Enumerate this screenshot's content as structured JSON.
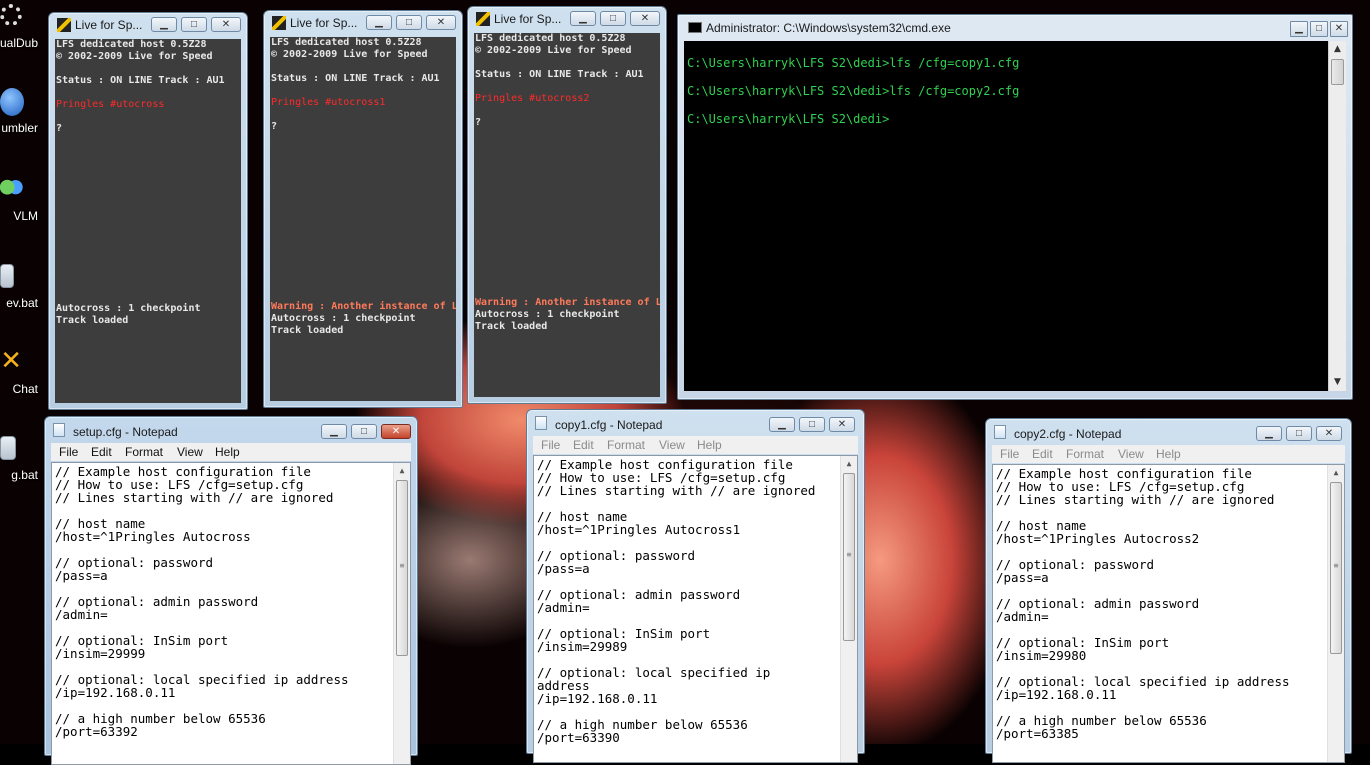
{
  "desktop": {
    "icons": [
      {
        "label": "ualDub",
        "icon": "virtualdub-gear-icon"
      },
      {
        "label": "umbler",
        "icon": "stumbleupon-icon"
      },
      {
        "label": "VLM",
        "icon": "windows-live-messenger-icon"
      },
      {
        "label": "ev.bat",
        "icon": "batch-file-icon"
      },
      {
        "label": "Chat",
        "icon": "chat-x-icon"
      },
      {
        "label": "g.bat",
        "icon": "batch-file-icon"
      }
    ]
  },
  "lfs_windows": [
    {
      "title": "Live for Sp...",
      "lines": {
        "header1": "LFS dedicated host 0.5Z28",
        "header2": "© 2002-2009 Live for Speed",
        "status": "Status : ON LINE    Track : AU1",
        "host": "Pringles #utocross",
        "prompt": "?",
        "warning": "",
        "checkpoint": "Autocross : 1 checkpoint",
        "loaded": "Track loaded"
      }
    },
    {
      "title": "Live for Sp...",
      "lines": {
        "header1": "LFS dedicated host 0.5Z28",
        "header2": "© 2002-2009 Live for Speed",
        "status": "Status : ON LINE    Track : AU1",
        "host": "Pringles #utocross1",
        "prompt": "?",
        "warning": "Warning : Another instance of LFS is",
        "checkpoint": "Autocross : 1 checkpoint",
        "loaded": "Track loaded"
      }
    },
    {
      "title": "Live for Sp...",
      "lines": {
        "header1": "LFS dedicated host 0.5Z28",
        "header2": "© 2002-2009 Live for Speed",
        "status": "Status : ON LINE    Track : AU1",
        "host": "Pringles #utocross2",
        "prompt": "?",
        "warning": "Warning : Another instance of LFS is",
        "checkpoint": "Autocross : 1 checkpoint",
        "loaded": "Track loaded"
      }
    }
  ],
  "cmd": {
    "title": "Administrator: C:\\Windows\\system32\\cmd.exe",
    "lines": [
      "C:\\Users\\harryk\\LFS S2\\dedi>lfs /cfg=copy1.cfg",
      "C:\\Users\\harryk\\LFS S2\\dedi>lfs /cfg=copy2.cfg",
      "C:\\Users\\harryk\\LFS S2\\dedi>"
    ]
  },
  "notepad_menu": [
    "File",
    "Edit",
    "Format",
    "View",
    "Help"
  ],
  "notepads": [
    {
      "title": "setup.cfg - Notepad",
      "lines": [
        "// Example host configuration file",
        "// How to use: LFS /cfg=setup.cfg",
        "// Lines starting with // are ignored",
        "",
        "// host name",
        "/host=^1Pringles Autocross",
        "",
        "// optional: password",
        "/pass=a",
        "",
        "// optional: admin password",
        "/admin=",
        "",
        "// optional: InSim port",
        "/insim=29999",
        "",
        "// optional: local specified ip address",
        "/ip=192.168.0.11",
        "",
        "// a high number below 65536",
        "/port=63392"
      ]
    },
    {
      "title": "copy1.cfg - Notepad",
      "lines": [
        "// Example host configuration file",
        "// How to use: LFS /cfg=setup.cfg",
        "// Lines starting with // are ignored",
        "",
        "// host name",
        "/host=^1Pringles Autocross1",
        "",
        "// optional: password",
        "/pass=a",
        "",
        "// optional: admin password",
        "/admin=",
        "",
        "// optional: InSim port",
        "/insim=29989",
        "",
        "// optional: local specified ip",
        "address",
        "/ip=192.168.0.11",
        "",
        "// a high number below 65536",
        "/port=63390"
      ]
    },
    {
      "title": "copy2.cfg - Notepad",
      "lines": [
        "// Example host configuration file",
        "// How to use: LFS /cfg=setup.cfg",
        "// Lines starting with // are ignored",
        "",
        "// host name",
        "/host=^1Pringles Autocross2",
        "",
        "// optional: password",
        "/pass=a",
        "",
        "// optional: admin password",
        "/admin=",
        "",
        "// optional: InSim port",
        "/insim=29980",
        "",
        "// optional: local specified ip address",
        "/ip=192.168.0.11",
        "",
        "// a high number below 65536",
        "/port=63385"
      ]
    }
  ],
  "window_controls": {
    "minimize": "▁",
    "maximize": "□",
    "close": "✕"
  },
  "colors": {
    "console_green": "#30d050",
    "lfs_red": "#ff2a2a",
    "warning": "#ff7a5a"
  }
}
